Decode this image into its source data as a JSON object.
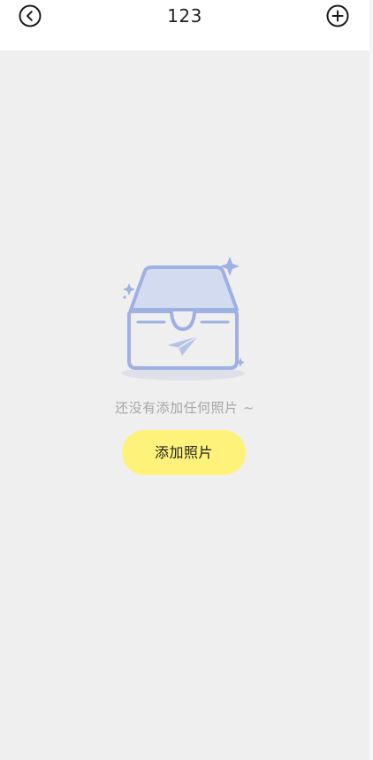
{
  "header": {
    "title": "123",
    "back_icon": "chevron-left-circle-icon",
    "add_icon": "plus-circle-icon"
  },
  "empty_state": {
    "illustration_icon": "empty-inbox-icon",
    "message": "还没有添加任何照片 ~",
    "add_button_label": "添加照片"
  },
  "colors": {
    "background": "#efefef",
    "header_background": "#ffffff",
    "button_yellow": "#fff27a",
    "illustration_blue": "#9fb0e2",
    "illustration_fill": "#d3dbf0",
    "message_gray": "#a6a6a6"
  }
}
